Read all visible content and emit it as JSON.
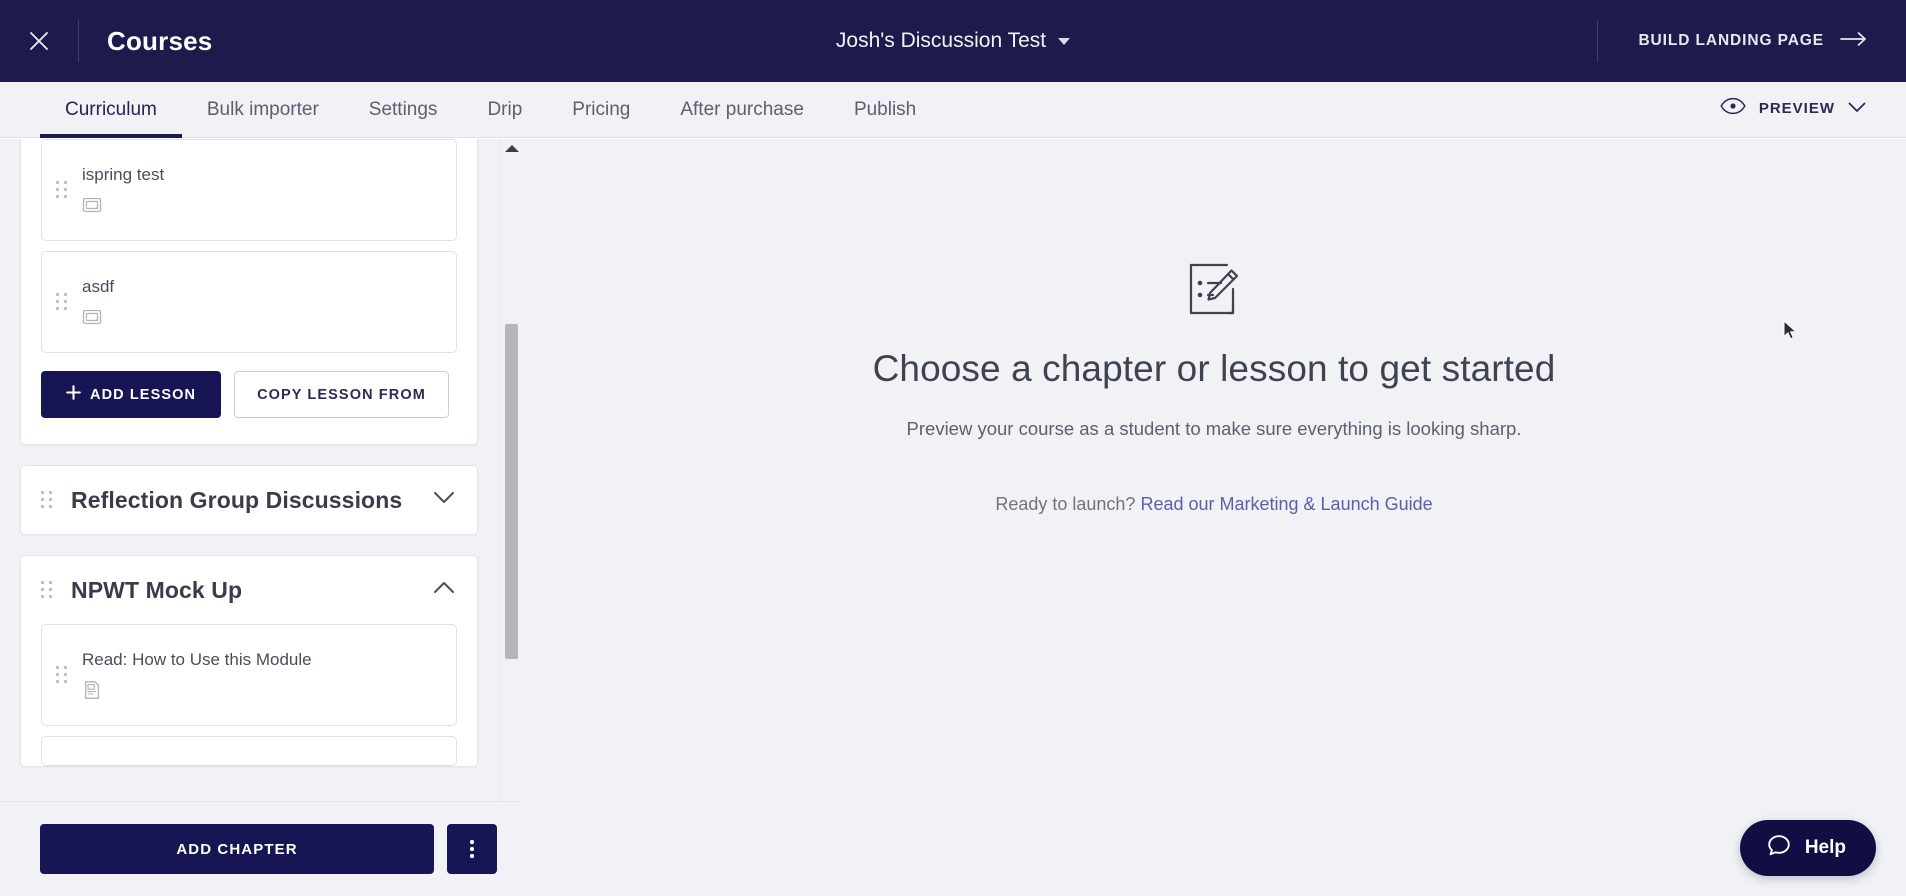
{
  "topbar": {
    "close_icon": "close-icon",
    "title": "Courses",
    "course_name": "Josh's Discussion Test",
    "build_landing_label": "BUILD LANDING PAGE",
    "arrow_icon": "arrow-right-icon",
    "bg_color": "#1d1b4b"
  },
  "tabs": [
    {
      "label": "Curriculum",
      "active": true
    },
    {
      "label": "Bulk importer",
      "active": false
    },
    {
      "label": "Settings",
      "active": false
    },
    {
      "label": "Drip",
      "active": false
    },
    {
      "label": "Pricing",
      "active": false
    },
    {
      "label": "After purchase",
      "active": false
    },
    {
      "label": "Publish",
      "active": false
    }
  ],
  "preview": {
    "label": "PREVIEW",
    "eye_icon": "eye-icon",
    "chevron_icon": "chevron-down-icon"
  },
  "sidebar": {
    "open_chapter_lessons": [
      {
        "title": "ispring test",
        "icon": "presentation-icon"
      },
      {
        "title": "asdf",
        "icon": "presentation-icon"
      }
    ],
    "add_lesson_label": "ADD LESSON",
    "copy_lesson_label": "COPY LESSON FROM",
    "chapters": [
      {
        "title": "Reflection Group Discussions",
        "expanded": false,
        "chevron": "chevron-down-icon"
      },
      {
        "title": "NPWT Mock Up",
        "expanded": true,
        "chevron": "chevron-up-icon"
      }
    ],
    "npwt_lessons": [
      {
        "title": "Read: How to Use this Module",
        "icon": "text-document-icon"
      }
    ],
    "add_chapter_label": "ADD CHAPTER",
    "kebab_icon": "kebab-menu-icon",
    "scrollbar_up_icon": "scroll-up-arrow-icon"
  },
  "main": {
    "icon": "edit-checklist-icon",
    "title": "Choose a chapter or lesson to get started",
    "subtitle": "Preview your course as a student to make sure everything is looking sharp.",
    "launch_prefix": "Ready to launch? ",
    "launch_link": "Read our Marketing & Launch Guide",
    "link_color": "#5b5fa8"
  },
  "help": {
    "label": "Help",
    "icon": "chat-bubble-icon",
    "bg_color": "#110e44"
  }
}
